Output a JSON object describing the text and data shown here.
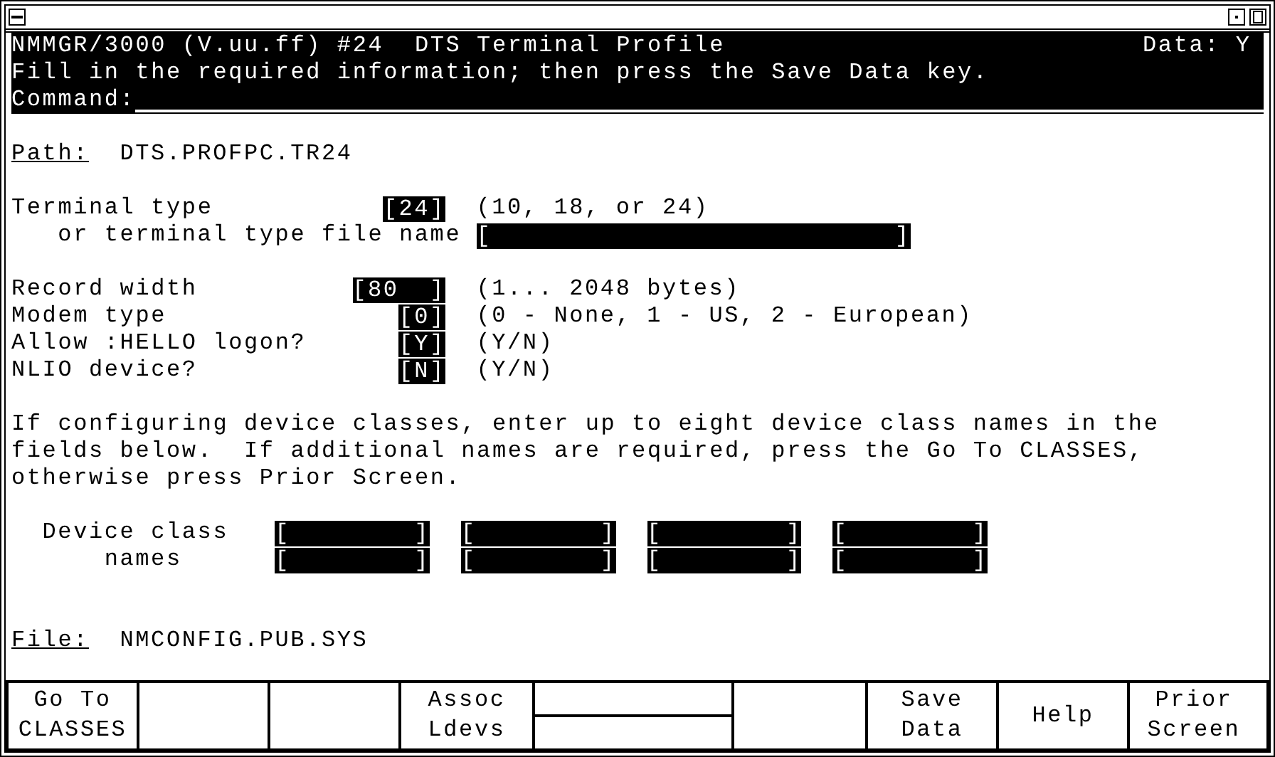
{
  "header": {
    "title": "NMMGR/3000 (V.uu.ff) #24  DTS Terminal Profile",
    "data_indicator": "Data: Y",
    "message": "Fill in the required information; then press the Save Data key.",
    "command_label": "Command:"
  },
  "path": {
    "label": "Path:",
    "value": "DTS.PROFPC.TR24"
  },
  "fields": [
    {
      "label": "Terminal type",
      "value": "[24]",
      "hint": "(10, 18, or 24)"
    },
    {
      "label": "or terminal type file name",
      "value": "[                          ]"
    },
    {
      "label": "Record width",
      "value": "[80  ]",
      "hint": "(1... 2048 bytes)"
    },
    {
      "label": "Modem type",
      "value": "[0]",
      "hint": "(0 - None, 1 - US, 2 - European)"
    },
    {
      "label": "Allow :HELLO logon?",
      "value": "[Y]",
      "hint": "(Y/N)"
    },
    {
      "label": "NLIO device?",
      "value": "[N]",
      "hint": "(Y/N)"
    }
  ],
  "instructions": [
    "If configuring device classes, enter up to eight device class names in the",
    "fields below.  If additional names are required, press the Go To CLASSES,",
    "otherwise press Prior Screen."
  ],
  "device_classes": {
    "label_lines": [
      "Device class",
      "names"
    ],
    "fields": [
      "[        ]",
      "[        ]",
      "[        ]",
      "[        ]",
      "[        ]",
      "[        ]",
      "[        ]",
      "[        ]"
    ]
  },
  "file": {
    "label": "File:",
    "value": "NMCONFIG.PUB.SYS"
  },
  "function_keys": [
    {
      "kind": "label",
      "lines": [
        "Go To",
        "CLASSES"
      ]
    },
    {
      "kind": "blank"
    },
    {
      "kind": "blank"
    },
    {
      "kind": "label",
      "lines": [
        "Assoc",
        "Ldevs"
      ]
    },
    {
      "kind": "split"
    },
    {
      "kind": "blank"
    },
    {
      "kind": "label",
      "lines": [
        "Save",
        "Data"
      ]
    },
    {
      "kind": "label",
      "lines": [
        "Help"
      ]
    },
    {
      "kind": "label",
      "lines": [
        "Prior",
        "Screen"
      ]
    }
  ]
}
